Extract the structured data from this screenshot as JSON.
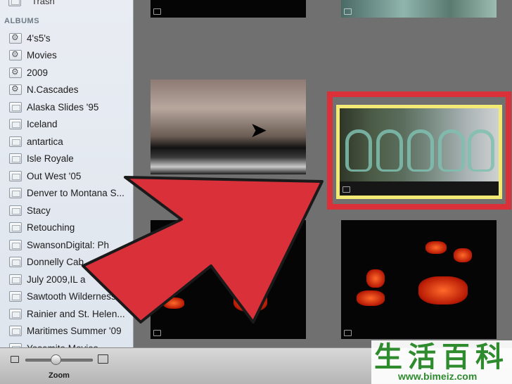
{
  "sidebar": {
    "trash_label": "Trash",
    "section_header": "ALBUMS",
    "albums": [
      {
        "label": "4's5's",
        "kind": "smart"
      },
      {
        "label": "Movies",
        "kind": "smart"
      },
      {
        "label": "2009",
        "kind": "smart"
      },
      {
        "label": "N.Cascades",
        "kind": "smart"
      },
      {
        "label": "Alaska Slides '95",
        "kind": "plain"
      },
      {
        "label": "Iceland",
        "kind": "plain"
      },
      {
        "label": "antartica",
        "kind": "plain"
      },
      {
        "label": "Isle Royale",
        "kind": "plain"
      },
      {
        "label": "Out West '05",
        "kind": "plain"
      },
      {
        "label": "Denver to Montana S...",
        "kind": "plain"
      },
      {
        "label": "Stacy",
        "kind": "plain"
      },
      {
        "label": "Retouching",
        "kind": "plain"
      },
      {
        "label": "SwansonDigital: Ph",
        "kind": "plain"
      },
      {
        "label": "Donnelly Cab",
        "kind": "plain"
      },
      {
        "label": "July 2009,IL a",
        "kind": "plain"
      },
      {
        "label": "Sawtooth Wilderness...",
        "kind": "plain"
      },
      {
        "label": "Rainier and St. Helen...",
        "kind": "plain"
      },
      {
        "label": "Maritimes Summer '09",
        "kind": "plain"
      },
      {
        "label": "Yosemite Movies",
        "kind": "plain"
      }
    ]
  },
  "toolbar": {
    "zoom_label": "Zoom",
    "zoom_level": 0.45
  },
  "watermark": {
    "chars": "生活百科",
    "url": "www.bimeiz.com"
  },
  "colors": {
    "highlight_frame": "#d9303a",
    "selection_border": "#f2ea74",
    "arrow_fill": "#d9303a"
  }
}
